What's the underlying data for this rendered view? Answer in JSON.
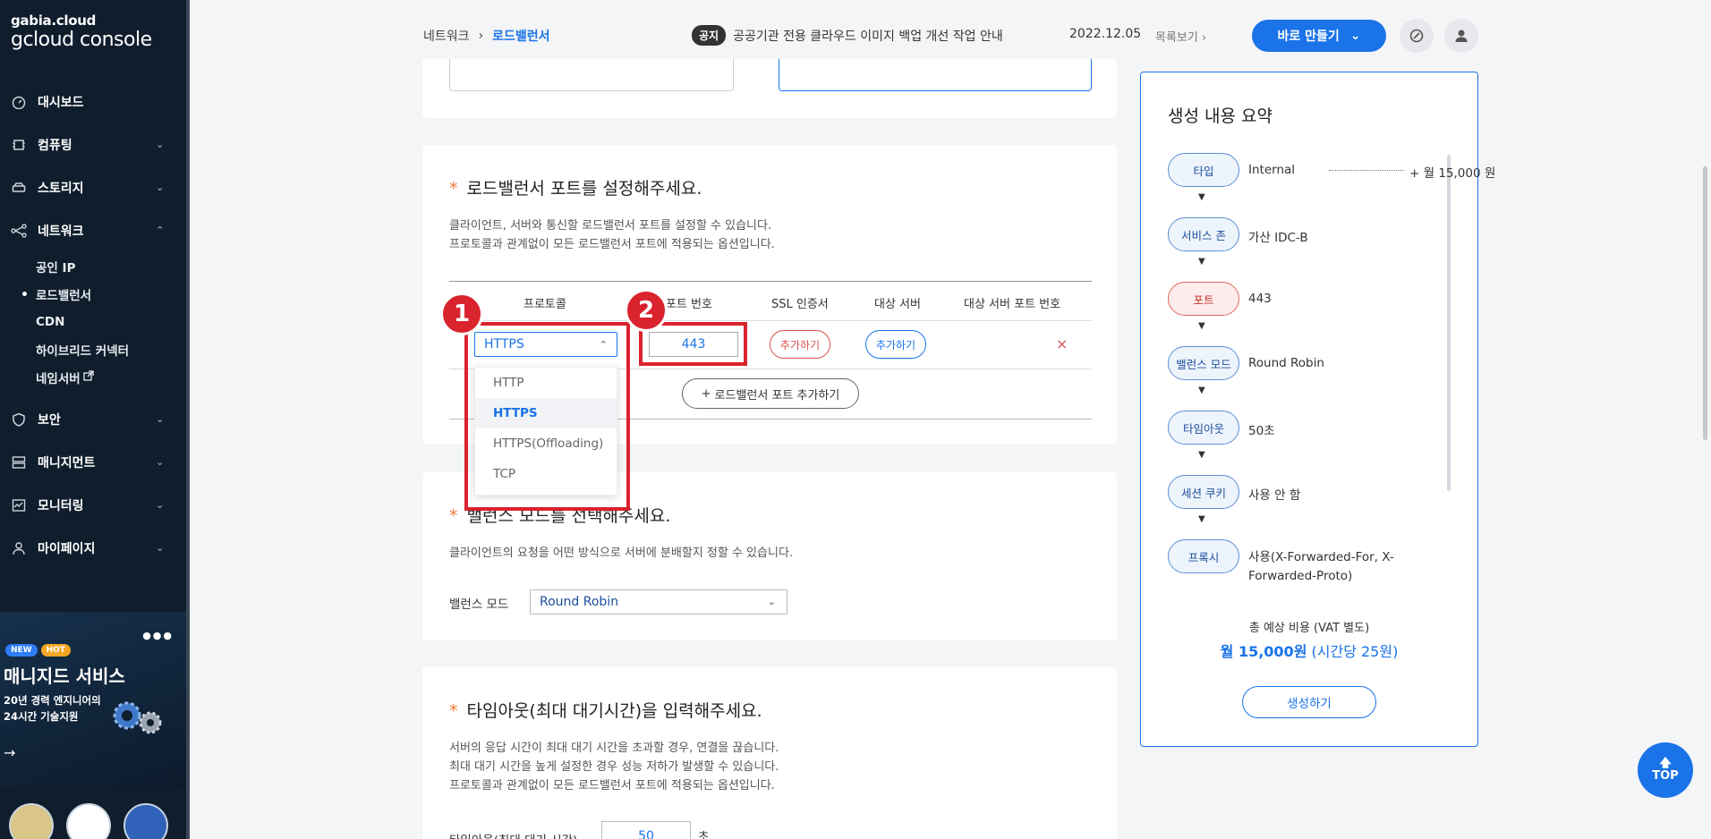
{
  "sidebar": {
    "logo_top": "gabia.cloud",
    "logo_bottom": "gcloud console",
    "items": [
      {
        "label": "대시보드",
        "icon": "dashboard-icon"
      },
      {
        "label": "컴퓨팅",
        "icon": "cpu-icon"
      },
      {
        "label": "스토리지",
        "icon": "storage-icon"
      },
      {
        "label": "네트워크",
        "icon": "network-icon"
      },
      {
        "label": "보안",
        "icon": "shield-icon"
      },
      {
        "label": "매니지먼트",
        "icon": "management-icon"
      },
      {
        "label": "모니터링",
        "icon": "monitoring-icon"
      },
      {
        "label": "마이페이지",
        "icon": "user-icon"
      }
    ],
    "network_sub": [
      "공인 IP",
      "로드밸런서",
      "CDN",
      "하이브리드 커넥터",
      "네임서버"
    ],
    "promo": {
      "badge_new": "NEW",
      "badge_hot": "HOT",
      "title": "매니지드 서비스",
      "line1": "20년 경력 엔지니어의",
      "line2": "24시간 기술지원",
      "arrow": "→"
    }
  },
  "header": {
    "breadcrumb_parent": "네트워크",
    "breadcrumb_sep": "›",
    "breadcrumb_current": "로드밸런서",
    "notice_tag": "공지",
    "notice_text": "공공기관 전용 클라우드 이미지 백업 개선 작업 안내",
    "notice_date": "2022.12.05",
    "notice_more": "목록보기",
    "make_button": "바로 만들기"
  },
  "port_section": {
    "title": "로드밸런서 포트를 설정해주세요.",
    "desc1": "클라이언트, 서버와 통신할 로드밸런서 포트를 설정할 수 있습니다.",
    "desc2": "프로토콜과 관계없이 모든 로드밸런서 포트에 적용되는 옵션입니다.",
    "columns": [
      "프로토콜",
      "포트 번호",
      "SSL 인증서",
      "대상 서버",
      "대상 서버 포트 번호"
    ],
    "row": {
      "protocol": "HTTPS",
      "port": "443",
      "ssl_button": "추가하기",
      "target_button": "추가하기",
      "delete": "×"
    },
    "add_port_button": "로드밸런서 포트 추가하기",
    "protocol_options": [
      "HTTP",
      "HTTPS",
      "HTTPS(Offloading)",
      "TCP"
    ],
    "selected_option": "HTTPS"
  },
  "annotations": {
    "one": "1",
    "two": "2"
  },
  "balance_section": {
    "title": "밸런스 모드를 선택해주세요.",
    "desc": "클라이언트의 요청을 어떤 방식으로 서버에 분배할지 정할 수 있습니다.",
    "label": "밸런스 모드",
    "value": "Round Robin"
  },
  "timeout_section": {
    "title": "타임아웃(최대 대기시간)을 입력해주세요.",
    "desc1": "서버의 응답 시간이 최대 대기 시간을 초과할 경우, 연결을 끊습니다.",
    "desc2": "최대 대기 시간을 높게 설정한 경우 성능 저하가 발생할 수 있습니다.",
    "desc3": "프로토콜과 관계없이 모든 로드밸런서 포트에 적용되는 옵션입니다.",
    "label": "타임아웃(최대 대기 시간)",
    "value": "50",
    "unit": "초"
  },
  "summary": {
    "title": "생성 내용 요약",
    "steps": [
      {
        "chip": "타입",
        "value": "Internal",
        "price": "+ 월 15,000 원"
      },
      {
        "chip": "서비스 존",
        "value": "가산 IDC-B"
      },
      {
        "chip": "포트",
        "value": "443"
      },
      {
        "chip": "밸런스 모드",
        "value": "Round Robin"
      },
      {
        "chip": "타임아웃",
        "value": "50초"
      },
      {
        "chip": "세션 쿠키",
        "value": "사용 안 함"
      },
      {
        "chip": "프록시",
        "value": "사용(X-Forwarded-For, X-Forwarded-Proto)"
      }
    ],
    "cost_label": "총 예상 비용 (VAT 별도)",
    "cost_main": "월 15,000원",
    "cost_sub": "(시간당 25원)",
    "create_button": "생성하기"
  },
  "top_button": "TOP"
}
